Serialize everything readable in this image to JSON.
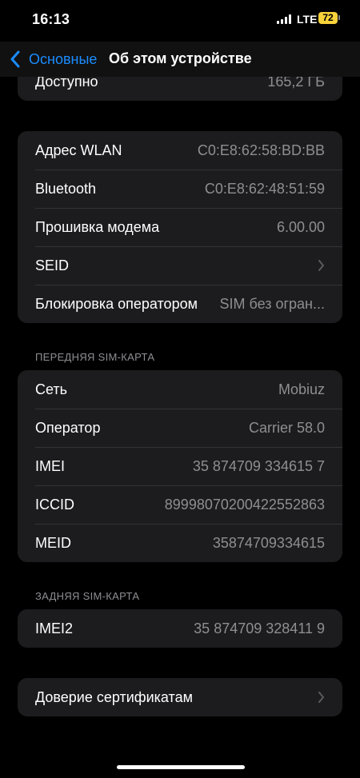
{
  "status_bar": {
    "time": "16:13",
    "network": "LTE",
    "battery": "72",
    "battery_color": "#f7d23a"
  },
  "nav": {
    "back_label": "Основные",
    "title": "Об этом устройстве"
  },
  "storage_group": {
    "available_label": "Доступно",
    "available_value": "165,2 ГБ"
  },
  "network_group": {
    "rows": [
      {
        "label": "Адрес WLAN",
        "value": "C0:E8:62:58:BD:BB"
      },
      {
        "label": "Bluetooth",
        "value": "C0:E8:62:48:51:59"
      },
      {
        "label": "Прошивка модема",
        "value": "6.00.00"
      },
      {
        "label": "SEID",
        "value": ""
      },
      {
        "label": "Блокировка оператором",
        "value": "SIM без огран..."
      }
    ]
  },
  "front_sim": {
    "header": "ПЕРЕДНЯЯ SIM-КАРТА",
    "rows": [
      {
        "label": "Сеть",
        "value": "Mobiuz"
      },
      {
        "label": "Оператор",
        "value": "Carrier 58.0"
      },
      {
        "label": "IMEI",
        "value": "35 874709 334615 7"
      },
      {
        "label": "ICCID",
        "value": "89998070200422552863"
      },
      {
        "label": "MEID",
        "value": "35874709334615"
      }
    ]
  },
  "back_sim": {
    "header": "ЗАДНЯЯ SIM-КАРТА",
    "rows": [
      {
        "label": "IMEI2",
        "value": "35 874709 328411 9"
      }
    ]
  },
  "certificates": {
    "label": "Доверие сертификатам"
  },
  "colors": {
    "accent": "#1a8cff",
    "cell_background": "#1c1c1e",
    "secondary_text": "#8e8e93"
  }
}
